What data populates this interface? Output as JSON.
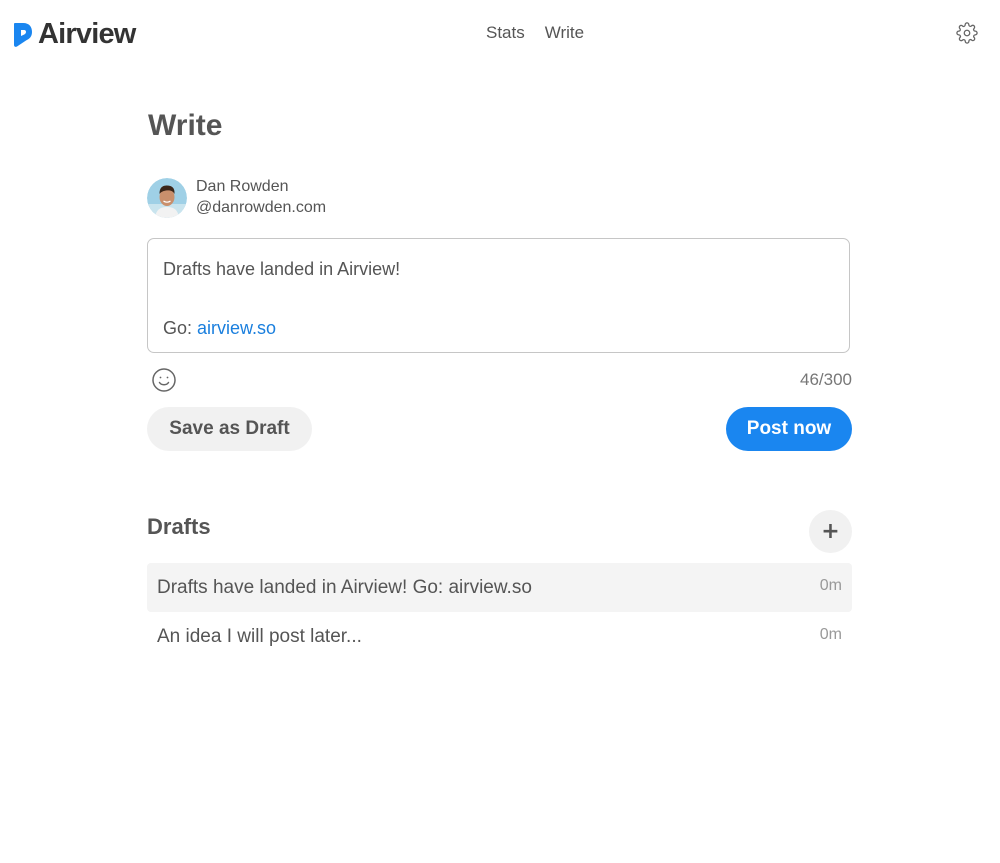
{
  "header": {
    "brand": "Airview",
    "nav": [
      {
        "label": "Stats"
      },
      {
        "label": "Write"
      }
    ]
  },
  "page": {
    "title": "Write"
  },
  "author": {
    "name": "Dan Rowden",
    "handle": "@danrowden.com"
  },
  "composer": {
    "line1": "Drafts have landed in Airview!",
    "line2_prefix": "Go: ",
    "line2_link": "airview.so",
    "char_count": "46/300"
  },
  "actions": {
    "save_draft_label": "Save as Draft",
    "post_now_label": "Post now"
  },
  "drafts": {
    "title": "Drafts",
    "add_label": "+",
    "items": [
      {
        "text": "Drafts have landed in Airview! Go: airview.so",
        "time": "0m"
      },
      {
        "text": "An idea I will post later...",
        "time": "0m"
      }
    ]
  },
  "colors": {
    "accent": "#1a86f0",
    "link": "#1a7fde",
    "brand": "#1a86f0",
    "text": "#555555"
  },
  "icons": {
    "settings": "gear-icon",
    "emoji": "smiley-icon",
    "logo": "airview-logo-icon"
  }
}
